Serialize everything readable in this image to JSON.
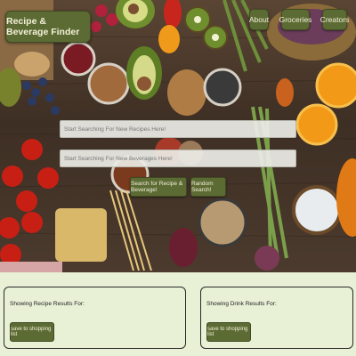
{
  "header": {
    "brand": "Recipe & Beverage Finder",
    "nav": {
      "about": "About",
      "groceries": "Groceries",
      "creators": "Creators"
    }
  },
  "search": {
    "recipes_placeholder": "Start Searching For New Recipes Here!",
    "beverages_placeholder": "Start Searching For New Beverages Here!",
    "search_button": "Search for Recipe & Beverage!",
    "random_button": "Random Search!"
  },
  "results": {
    "recipe_title": "Showing Recipe Results For:",
    "drink_title": "Showing Drink Results For:",
    "recipe_save": "save to shopping list",
    "drink_save": "save to shopping list"
  },
  "colors": {
    "button": "#5c6b34",
    "button_text": "#f3f0d8",
    "page_background": "#e8f0d6"
  }
}
